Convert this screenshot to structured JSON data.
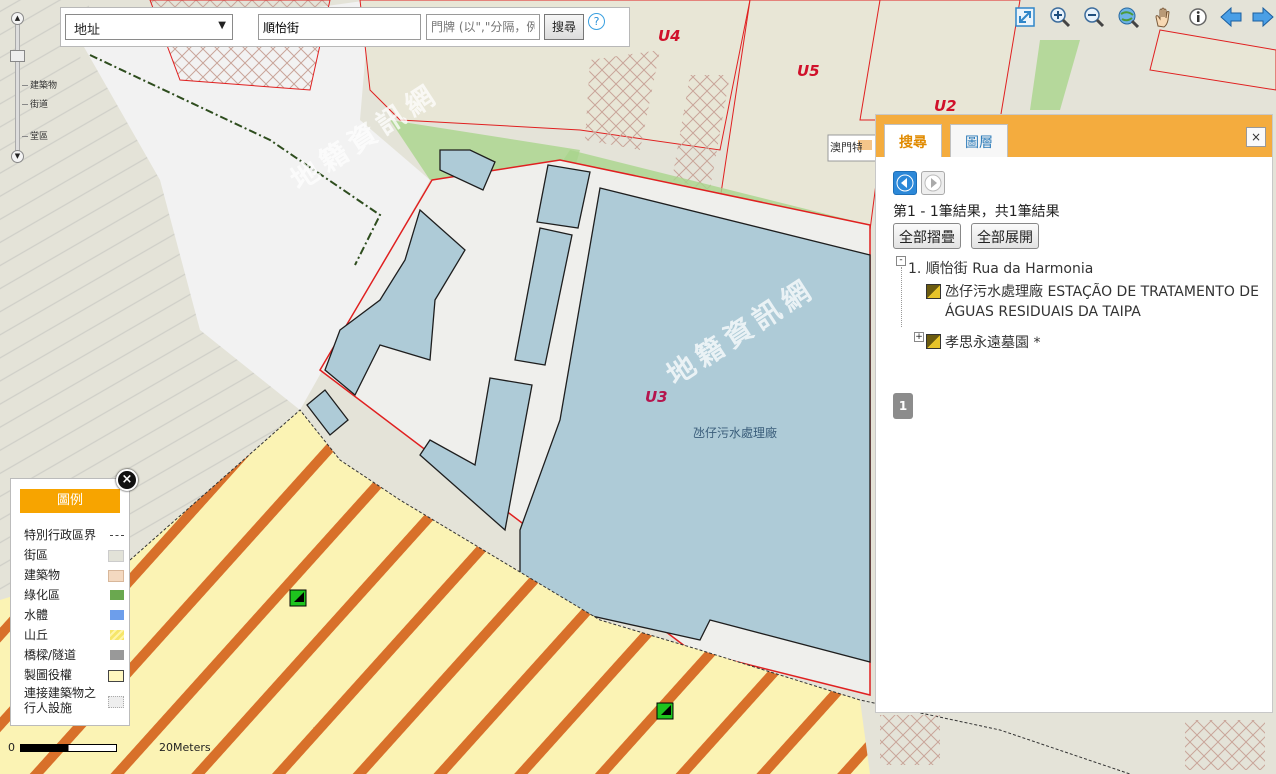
{
  "search": {
    "type_selected": "地址",
    "street_value": "順怡街",
    "door_placeholder": "門牌 (以\",\"分隔，例",
    "search_button": "搜尋",
    "help": "?"
  },
  "zoom_levels": [
    "建築物",
    "街道",
    "堂區"
  ],
  "map_labels": {
    "parcel_u4": "U4",
    "parcel_u5": "U5",
    "parcel_u2": "U2",
    "parcel_u3": "U3",
    "plant_name": "氹仔污水處理廠",
    "partial_label": "澳門特殊",
    "watermark": "地籍資訊網"
  },
  "panel": {
    "tab_search": "搜尋",
    "tab_layers": "圖層",
    "close": "×",
    "summary": "第1 - 1筆結果，共1筆結果",
    "collapse_all": "全部摺疊",
    "expand_all": "全部展開",
    "result_root": "1. 順怡街 Rua da Harmonia",
    "result_child1": "氹仔污水處理廠 ESTAÇÃO DE TRATAMENTO DE ÁGUAS RESIDUAIS DA TAIPA",
    "result_child2": "孝思永遠墓園 *",
    "page": "1"
  },
  "legend": {
    "title": "圖例",
    "items": [
      {
        "label": "特別行政區界",
        "color": "#444444"
      },
      {
        "label": "街區",
        "color": "#e2e2d8"
      },
      {
        "label": "建築物",
        "color": "#f4d9c0"
      },
      {
        "label": "綠化區",
        "color": "#6aa84f"
      },
      {
        "label": "水體",
        "color": "#6d9eeb"
      },
      {
        "label": "山丘",
        "color": "#f6e66a"
      },
      {
        "label": "橋樑/隧道",
        "color": "#999999"
      },
      {
        "label": "製圖役權",
        "color": "#fff7c0"
      },
      {
        "label": "連接建築物之行人設施",
        "color": "#eeeeee"
      }
    ]
  },
  "scale": {
    "zero": "0",
    "label": "20Meters"
  }
}
